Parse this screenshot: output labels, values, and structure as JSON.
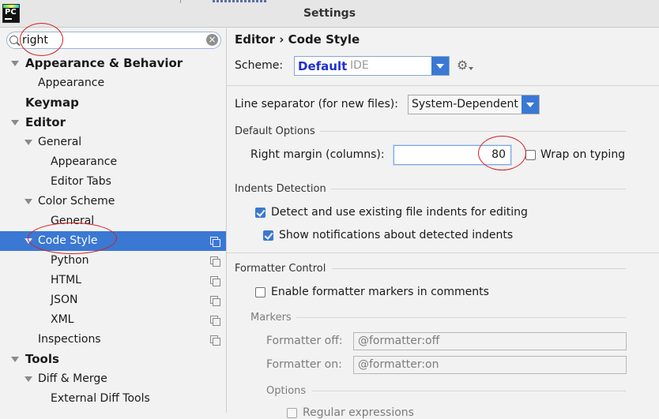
{
  "window": {
    "title": "Settings",
    "app_icon": "pycharm-logo",
    "app_icon_text": "PC"
  },
  "sidebar": {
    "search": {
      "value": "right",
      "placeholder": ""
    },
    "tree": [
      {
        "label": "Appearance & Behavior",
        "level": 0,
        "expanded": true,
        "bold": true
      },
      {
        "label": "Appearance",
        "level": 1
      },
      {
        "label": "Keymap",
        "level": 0,
        "bold": true
      },
      {
        "label": "Editor",
        "level": 0,
        "expanded": true,
        "bold": true
      },
      {
        "label": "General",
        "level": 1,
        "expanded": true
      },
      {
        "label": "Appearance",
        "level": 2
      },
      {
        "label": "Editor Tabs",
        "level": 2
      },
      {
        "label": "Color Scheme",
        "level": 1,
        "expanded": true
      },
      {
        "label": "General",
        "level": 2
      },
      {
        "label": "Code Style",
        "level": 1,
        "expanded": true,
        "selected": true,
        "project_icon": true
      },
      {
        "label": "Python",
        "level": 2,
        "project_icon": true
      },
      {
        "label": "HTML",
        "level": 2,
        "project_icon": true
      },
      {
        "label": "JSON",
        "level": 2,
        "project_icon": true
      },
      {
        "label": "XML",
        "level": 2,
        "project_icon": true
      },
      {
        "label": "Inspections",
        "level": 1,
        "project_icon": true
      },
      {
        "label": "Tools",
        "level": 0,
        "expanded": true,
        "bold": true
      },
      {
        "label": "Diff & Merge",
        "level": 1,
        "expanded": true
      },
      {
        "label": "External Diff Tools",
        "level": 2
      }
    ]
  },
  "main": {
    "breadcrumb": "Editor › Code Style",
    "scheme": {
      "label": "Scheme:",
      "value": "Default",
      "tag": "IDE",
      "gear_icon": "gear-icon"
    },
    "line_separator": {
      "label": "Line separator (for new files):",
      "value": "System-Dependent"
    },
    "default_options": {
      "title": "Default Options",
      "right_margin_label": "Right margin (columns):",
      "right_margin_value": "80",
      "wrap_on_typing_label": "Wrap on typing",
      "wrap_on_typing_checked": false
    },
    "indents_detection": {
      "title": "Indents Detection",
      "detect_label": "Detect and use existing file indents for editing",
      "detect_checked": true,
      "notify_label": "Show notifications about detected indents",
      "notify_checked": true
    },
    "formatter_control": {
      "title": "Formatter Control",
      "enable_label": "Enable formatter markers in comments",
      "enable_checked": false,
      "markers_title": "Markers",
      "off_label": "Formatter off:",
      "off_value": "@formatter:off",
      "on_label": "Formatter on:",
      "on_value": "@formatter:on",
      "options_title": "Options",
      "regex_label": "Regular expressions",
      "regex_checked": false
    }
  },
  "colors": {
    "selection": "#3a78d4",
    "annotation": "#d41f1f",
    "scheme_value": "#1f2ed6"
  }
}
